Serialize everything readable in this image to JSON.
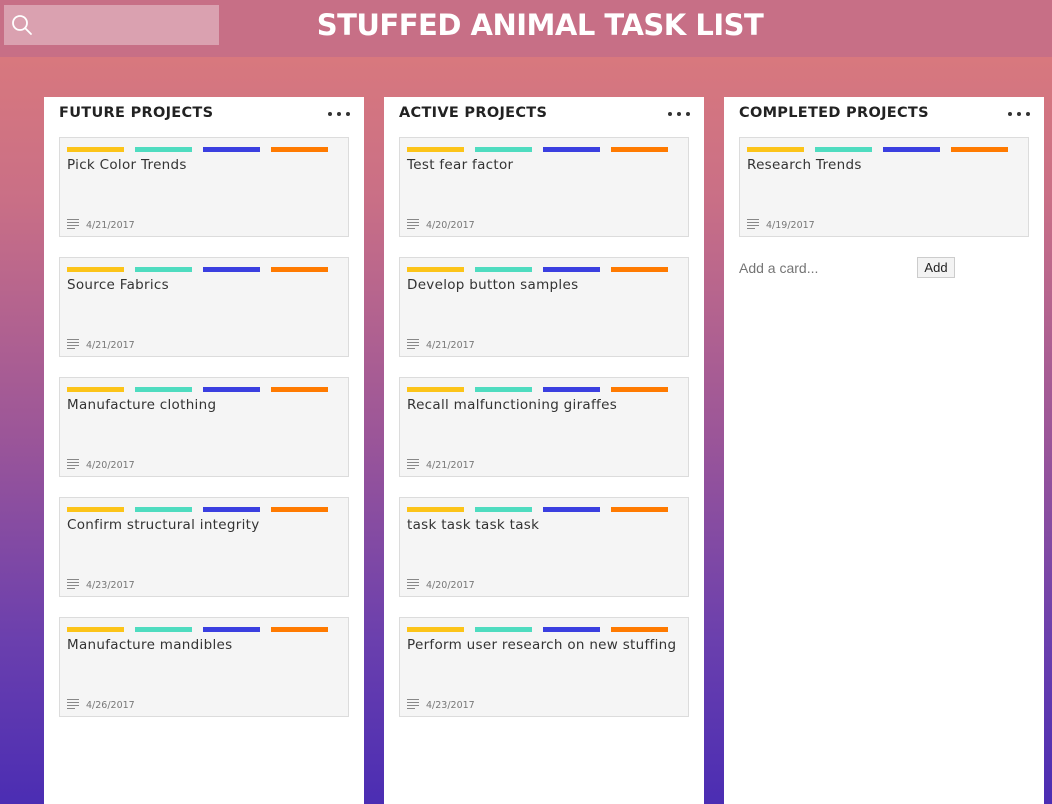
{
  "header": {
    "title": "STUFFED ANIMAL TASK LIST",
    "search_placeholder": "",
    "search_icon": "search-icon"
  },
  "label_colors": [
    "#fcc419",
    "#4fdcc0",
    "#3b3fe0",
    "#ff7a00"
  ],
  "columns": [
    {
      "title": "FUTURE PROJECTS",
      "cards": [
        {
          "title": "Pick Color Trends",
          "date": "4/21/2017"
        },
        {
          "title": "Source Fabrics",
          "date": "4/21/2017"
        },
        {
          "title": "Manufacture clothing",
          "date": "4/20/2017"
        },
        {
          "title": "Confirm structural integrity",
          "date": "4/23/2017"
        },
        {
          "title": "Manufacture mandibles",
          "date": "4/26/2017"
        }
      ]
    },
    {
      "title": "ACTIVE PROJECTS",
      "cards": [
        {
          "title": "Test fear factor",
          "date": "4/20/2017"
        },
        {
          "title": "Develop button samples",
          "date": "4/21/2017"
        },
        {
          "title": "Recall malfunctioning giraffes",
          "date": "4/21/2017"
        },
        {
          "title": "task task task task",
          "date": "4/20/2017"
        },
        {
          "title": "Perform user research on new stuffing",
          "date": "4/23/2017"
        }
      ]
    },
    {
      "title": "COMPLETED PROJECTS",
      "cards": [
        {
          "title": "Research Trends",
          "date": "4/19/2017"
        }
      ],
      "add_card_placeholder": "Add a card...",
      "add_button_label": "Add"
    }
  ]
}
